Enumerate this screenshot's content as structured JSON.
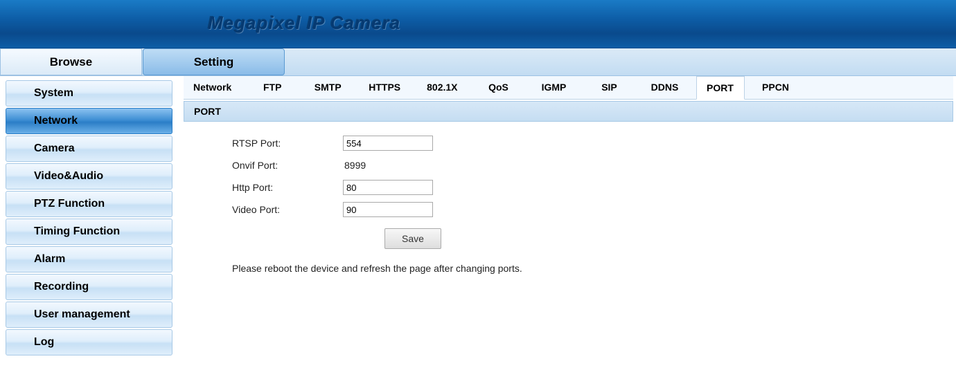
{
  "banner": {
    "title": "Megapixel IP Camera"
  },
  "topnav": {
    "browse": "Browse",
    "setting": "Setting"
  },
  "sidebar": {
    "items": [
      {
        "label": "System"
      },
      {
        "label": "Network"
      },
      {
        "label": "Camera"
      },
      {
        "label": "Video&Audio"
      },
      {
        "label": "PTZ Function"
      },
      {
        "label": "Timing Function"
      },
      {
        "label": "Alarm"
      },
      {
        "label": "Recording"
      },
      {
        "label": "User management"
      },
      {
        "label": "Log"
      }
    ],
    "active_index": 1
  },
  "subtabs": {
    "items": [
      "Network",
      "FTP",
      "SMTP",
      "HTTPS",
      "802.1X",
      "QoS",
      "IGMP",
      "SIP",
      "DDNS",
      "PORT",
      "PPCN"
    ],
    "active_index": 9
  },
  "section": {
    "header": "PORT"
  },
  "form": {
    "rtsp_label": "RTSP Port:",
    "rtsp_value": "554",
    "onvif_label": "Onvif Port:",
    "onvif_value": "8999",
    "http_label": "Http Port:",
    "http_value": "80",
    "video_label": "Video Port:",
    "video_value": "90",
    "save_label": "Save",
    "note": "Please reboot the device and refresh the page after changing ports."
  }
}
